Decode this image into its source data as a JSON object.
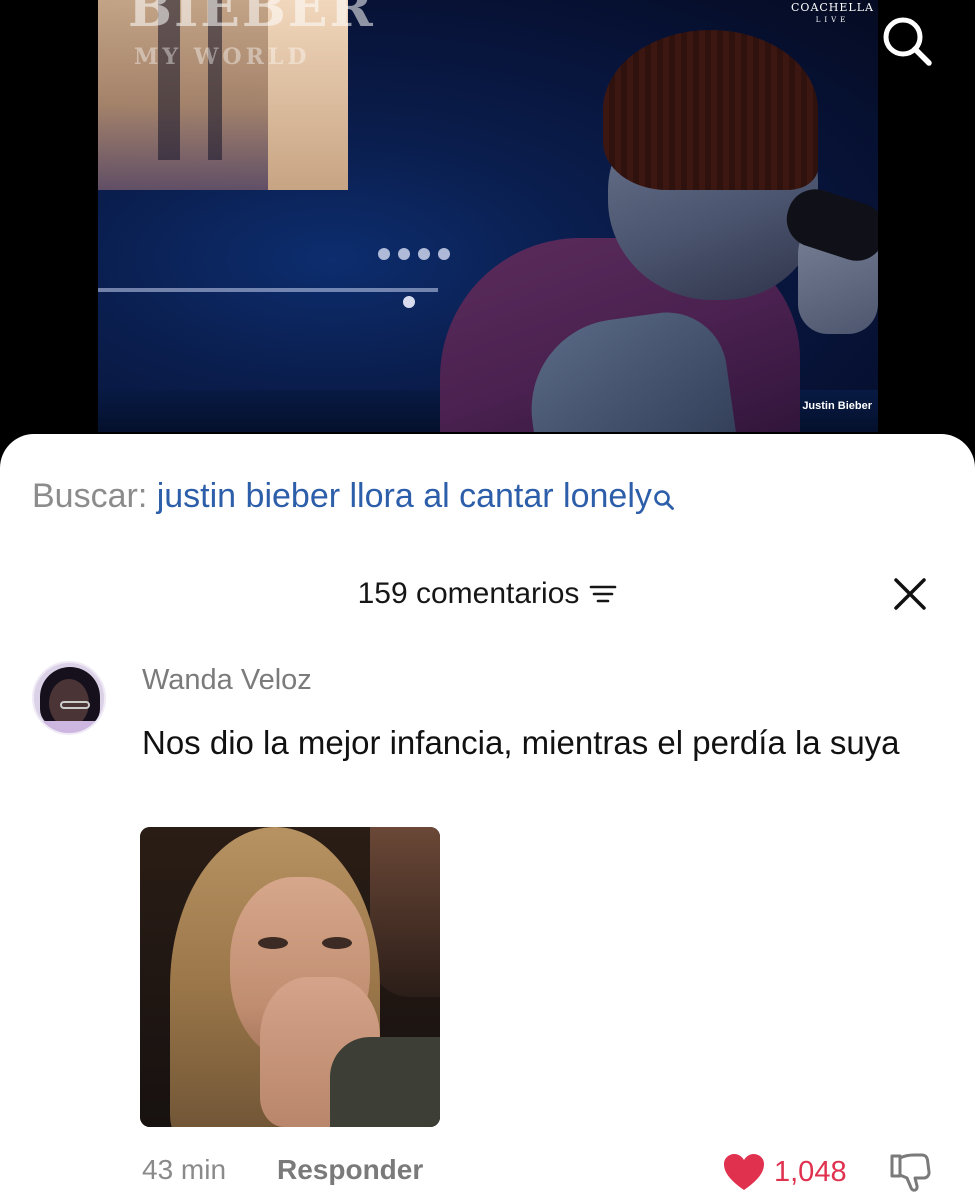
{
  "video": {
    "logo_text": "BIEBER",
    "logo_sub": "MY WORLD",
    "brand_tag": "COACHELLA",
    "brand_tag_sub": "LIVE",
    "caption_tag": "Justin Bieber"
  },
  "search_suggest": {
    "prefix": "Buscar: ",
    "query": "justin bieber llora al cantar lonely",
    "query_color": "#2d5ea9"
  },
  "comments": {
    "count_label": "159 comentarios",
    "items": [
      {
        "username": "Wanda Veloz",
        "text": "Nos dio la mejor infancia, mientras el perdía la suya",
        "time": "43 min",
        "reply_label": "Responder",
        "likes": "1,048",
        "liked": true
      }
    ]
  },
  "colors": {
    "like_red": "#e0324f",
    "sheet_bg": "#ffffff"
  }
}
